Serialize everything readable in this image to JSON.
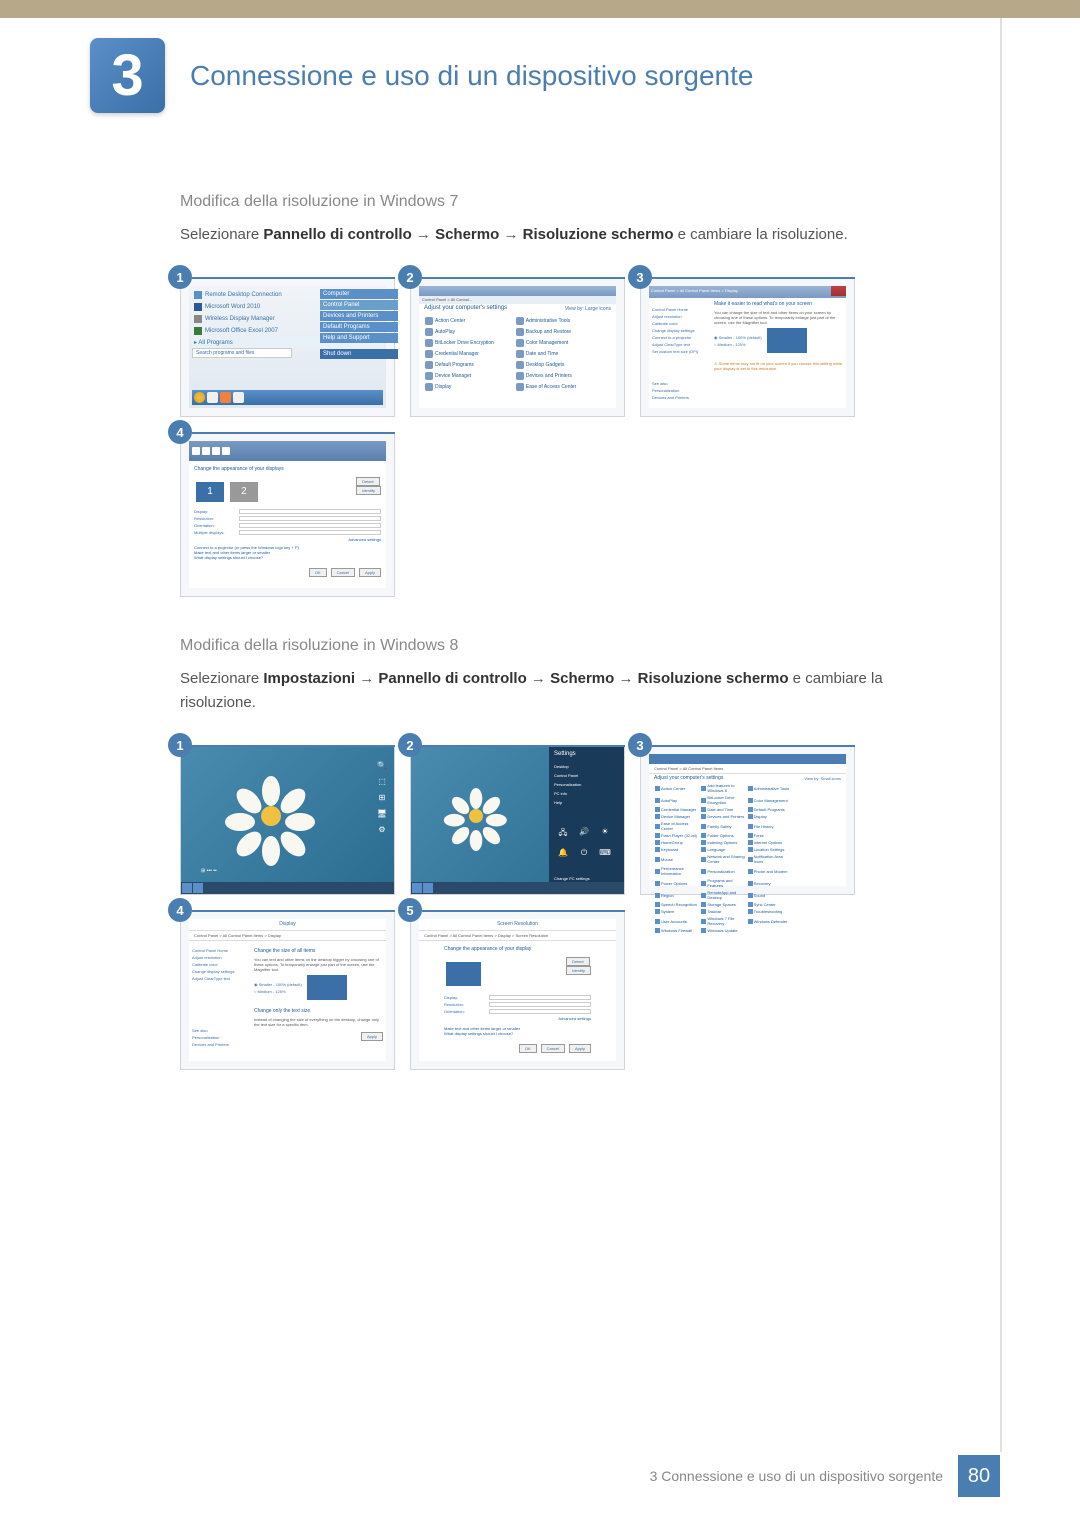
{
  "chapter": {
    "number": "3",
    "title": "Connessione e uso di un dispositivo sorgente"
  },
  "sections": {
    "win7": {
      "heading": "Modifica della risoluzione in Windows 7",
      "text_prefix": "Selezionare ",
      "path1": "Pannello di controllo",
      "arrow": " → ",
      "path2": "Schermo",
      "path3": "Risoluzione schermo",
      "text_suffix": " e cambiare la risoluzione."
    },
    "win8": {
      "heading": "Modifica della risoluzione in Windows 8",
      "text_prefix": "Selezionare ",
      "path1": "Impostazioni",
      "arrow": " → ",
      "path2": "Pannello di controllo",
      "path3": "Schermo",
      "path4": "Risoluzione schermo",
      "text_suffix": " e cambiare la risoluzione."
    }
  },
  "steps": {
    "s1": "1",
    "s2": "2",
    "s3": "3",
    "s4": "4",
    "s5": "5"
  },
  "win7_start": {
    "items": [
      "Remote Desktop Connection",
      "Microsoft Word 2010",
      "Wireless Display Manager",
      "Microsoft Office Excel 2007"
    ],
    "all_programs": "All Programs",
    "search": "Search programs and files",
    "right_items": [
      "Computer",
      "Control Panel",
      "Devices and Printers",
      "Default Programs",
      "Help and Support"
    ],
    "shutdown": "Shut down"
  },
  "win7_cp": {
    "breadcrumb": "Control Panel > All Control...",
    "heading": "Adjust your computer's settings",
    "view": "View by: Large icons",
    "items": [
      "Action Center",
      "Administrative Tools",
      "AutoPlay",
      "Backup and Restore",
      "BitLocker Drive Encryption",
      "Color Management",
      "Credential Manager",
      "Date and Time",
      "Default Programs",
      "Desktop Gadgets",
      "Device Manager",
      "Devices and Printers",
      "Display",
      "Ease of Access Center"
    ]
  },
  "win7_display": {
    "breadcrumb": "Control Panel > All Control Panel Items > Display",
    "sidebar": [
      "Control Panel Home",
      "Adjust resolution",
      "Calibrate color",
      "Change display settings",
      "Connect to a projector",
      "Adjust ClearType text",
      "Set custom text size (DPI)"
    ],
    "sidebar_bottom": [
      "See also",
      "Personalization",
      "Devices and Printers"
    ],
    "heading": "Make it easier to read what's on your screen",
    "text": "You can change the size of text and other items on your screen by choosing one of these options. To temporarily enlarge just part of the screen, use the Magnifier tool.",
    "options": [
      "Smaller - 100% (default)",
      "Medium - 125%"
    ],
    "note": "Some items may not fit on your screen if you choose this setting while your display is set to this resolution."
  },
  "win7_res": {
    "heading": "Change the appearance of your displays",
    "monitor1": "1",
    "monitor2": "2",
    "btn_detect": "Detect",
    "btn_identify": "Identify",
    "fields": {
      "display": "Display:",
      "resolution": "Resolution:",
      "orientation": "Orientation:",
      "multiple": "Multiple displays:"
    },
    "advanced": "Advanced settings",
    "link1": "Connect to a projector (or press the Windows logo key + P)",
    "link2": "Make text and other items larger or smaller",
    "link3": "What display settings should I choose?",
    "btn_ok": "OK",
    "btn_cancel": "Cancel",
    "btn_apply": "Apply"
  },
  "win8_settings": {
    "title": "Settings",
    "items": [
      "Desktop",
      "Control Panel",
      "Personalization",
      "PC info",
      "Help"
    ],
    "change": "Change PC settings"
  },
  "win8_cp_all": {
    "breadcrumb": "Control Panel > All Control Panel Items",
    "heading": "Adjust your computer's settings",
    "view": "View by: Small icons",
    "items": [
      "Action Center",
      "Add features to Windows 8",
      "Administrative Tools",
      "AutoPlay",
      "BitLocker Drive Encryption",
      "Color Management",
      "Credential Manager",
      "Date and Time",
      "Default Programs",
      "Device Manager",
      "Devices and Printers",
      "Display",
      "Ease of Access Center",
      "Family Safety",
      "File History",
      "Flash Player (32-bit)",
      "Folder Options",
      "Fonts",
      "HomeGroup",
      "Indexing Options",
      "Internet Options",
      "Keyboard",
      "Language",
      "Location Settings",
      "Mouse",
      "Network and Sharing Center",
      "Notification Area Icons",
      "Performance Information",
      "Personalization",
      "Phone and Modem",
      "Power Options",
      "Programs and Features",
      "Recovery",
      "Region",
      "RemoteApp and Desktop",
      "Sound",
      "Speech Recognition",
      "Storage Spaces",
      "Sync Center",
      "System",
      "Taskbar",
      "Troubleshooting",
      "User Accounts",
      "Windows 7 File Recovery",
      "Windows Defender",
      "Windows Firewall",
      "Windows Update"
    ]
  },
  "win8_display": {
    "breadcrumb": "Control Panel > All Control Panel Items > Display",
    "title": "Display",
    "sidebar": [
      "Control Panel Home",
      "Adjust resolution",
      "Calibrate color",
      "Change display settings",
      "Adjust ClearType text"
    ],
    "sidebar_bottom": [
      "See also",
      "Personalization",
      "Devices and Printers"
    ],
    "heading": "Change the size of all items",
    "text": "You can text and other items on the desktop bigger by choosing one of these options. To temporarily enlarge just part of the screen, use the Magnifier tool.",
    "options": [
      "Smaller - 100% (default)",
      "Medium - 125%"
    ],
    "heading2": "Change only the text size",
    "text2": "Instead of changing the size of everything on the desktop, change only the text size for a specific item.",
    "btn_apply": "Apply"
  },
  "win8_res": {
    "title": "Screen Resolution",
    "breadcrumb": "Control Panel > All Control Panel Items > Display > Screen Resolution",
    "heading": "Change the appearance of your display",
    "btn_detect": "Detect",
    "btn_identify": "Identify",
    "fields": {
      "display": "Display:",
      "resolution": "Resolution:",
      "orientation": "Orientation:"
    },
    "advanced": "Advanced settings",
    "link1": "Make text and other items larger or smaller",
    "link2": "What display settings should I choose?",
    "btn_ok": "OK",
    "btn_cancel": "Cancel",
    "btn_apply": "Apply"
  },
  "footer": {
    "text": "3 Connessione e uso di un dispositivo sorgente",
    "page": "80"
  }
}
